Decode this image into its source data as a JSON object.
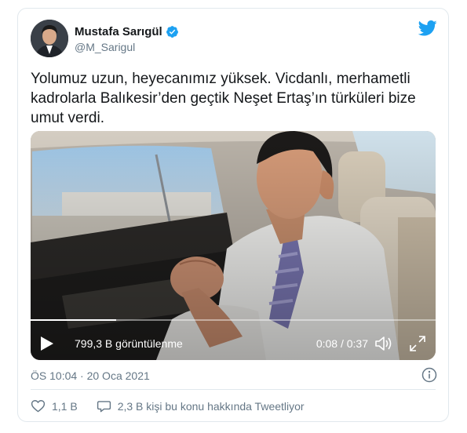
{
  "author": {
    "name": "Mustafa Sarıgül",
    "handle": "@M_Sarigul"
  },
  "tweet": {
    "text": "Yolumuz uzun, heyecanımız yüksek. Vicdanlı, merhametli kadrolarla Balıkesir’den geçtik Neşet Ertaş’ın türküleri bize umut verdi."
  },
  "video": {
    "views": "799,3 B görüntülenme",
    "time": "0:08 / 0:37",
    "progress": 0.216
  },
  "meta": {
    "timestamp": "ÖS 10:04 · 20 Oca 2021"
  },
  "actions": {
    "likes": "1,1 B",
    "conversation": "2,3 B kişi bu konu hakkında Tweetliyor"
  },
  "colors": {
    "accent": "#1da1f2",
    "muted": "#657786",
    "text": "#14171a",
    "border": "#e1e8ed"
  },
  "icons": {
    "brand": "twitter-bird-icon",
    "verified": "verified-badge-icon",
    "play": "play-icon",
    "volume": "volume-icon",
    "fullscreen": "fullscreen-icon",
    "info": "info-icon",
    "like": "heart-icon",
    "reply": "speech-bubble-icon"
  }
}
